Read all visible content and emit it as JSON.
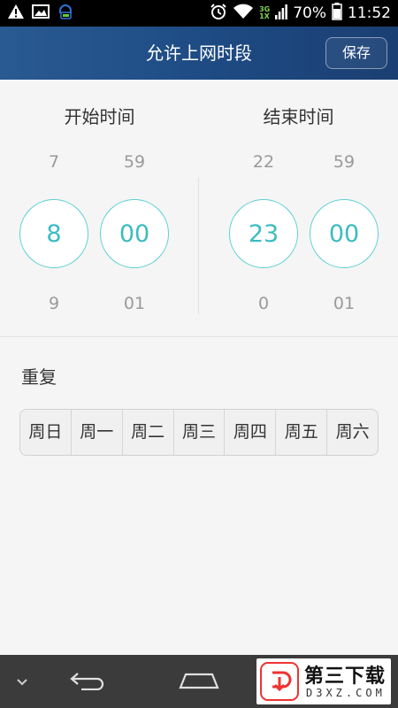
{
  "status_bar": {
    "network_label_top": "3G",
    "network_label_bottom": "1X",
    "battery": "70%",
    "time": "11:52",
    "icons": [
      "warning-icon",
      "image-icon",
      "headset-icon",
      "alarm-icon",
      "wifi-icon",
      "signal-icon",
      "battery-icon"
    ]
  },
  "header": {
    "title": "允许上网时段",
    "save_label": "保存"
  },
  "start": {
    "title": "开始时间",
    "hour": {
      "above": "7",
      "selected": "8",
      "below": "9"
    },
    "minute": {
      "above": "59",
      "selected": "00",
      "below": "01"
    }
  },
  "end": {
    "title": "结束时间",
    "hour": {
      "above": "22",
      "selected": "23",
      "below": "0"
    },
    "minute": {
      "above": "59",
      "selected": "00",
      "below": "01"
    }
  },
  "repeat": {
    "label": "重复",
    "days": [
      "周日",
      "周一",
      "周二",
      "周三",
      "周四",
      "周五",
      "周六"
    ]
  },
  "watermark": {
    "title": "第三下载",
    "subtitle": "D3XZ.COM"
  },
  "colors": {
    "accent": "#3bbcc0",
    "header": "#1f4d86"
  }
}
